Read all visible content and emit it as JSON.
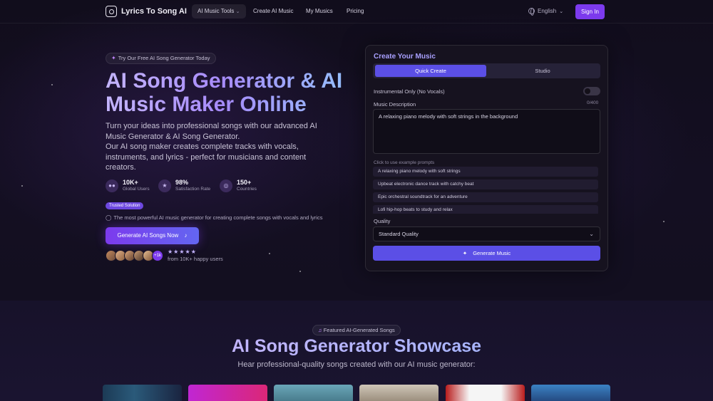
{
  "nav": {
    "brand": "Lyrics To Song AI",
    "links": [
      "AI Music Tools",
      "Create AI Music",
      "My Musics",
      "Pricing"
    ],
    "language": "English",
    "sign_in": "Sign In"
  },
  "hero": {
    "pill": "Try Our Free AI Song Generator Today",
    "title": "AI Song Generator & AI Music Maker Online",
    "description_1": "Turn your ideas into professional songs with our advanced AI Music Generator & AI Song Generator.",
    "description_2": "Our AI song maker creates complete tracks with vocals, instruments, and lyrics - perfect for musicians and content creators.",
    "stats": [
      {
        "value": "10K+",
        "label": "Global Users",
        "icon": "users-icon"
      },
      {
        "value": "98%",
        "label": "Satisfaction Rate",
        "icon": "award-icon"
      },
      {
        "value": "150+",
        "label": "Countries",
        "icon": "globe-icon"
      }
    ],
    "trusted_badge": "Trusted Solution",
    "trusted_desc": "The most powerful AI music generator for creating complete songs with vocals and lyrics",
    "cta": "Generate AI Songs Now",
    "avatars_more": "+1k",
    "rating_stars": "★★★★★",
    "happy_users": "from 10K+ happy users"
  },
  "create": {
    "title": "Create Your Music",
    "tabs": [
      "Quick Create",
      "Studio"
    ],
    "instrumental_label": "Instrumental Only (No Vocals)",
    "description_label": "Music Description",
    "counter": "0/400",
    "description_value": "A relaxing piano melody with soft strings in the background",
    "example_hint": "Click to use example prompts",
    "examples": [
      "A relaxing piano melody with soft strings",
      "Upbeat electronic dance track with catchy beat",
      "Epic orchestral soundtrack for an adventure",
      "Lofi hip-hop beats to study and relax"
    ],
    "quality_label": "Quality",
    "quality_value": "Standard Quality",
    "generate": "Generate Music"
  },
  "showcase": {
    "pill": "Featured AI-Generated Songs",
    "title": "AI Song Generator Showcase",
    "subtitle": "Hear professional-quality songs created with our AI music generator:"
  },
  "colors": {
    "accent": "#7c3aed",
    "button": "#5b4fe6",
    "background": "#100c1a"
  }
}
